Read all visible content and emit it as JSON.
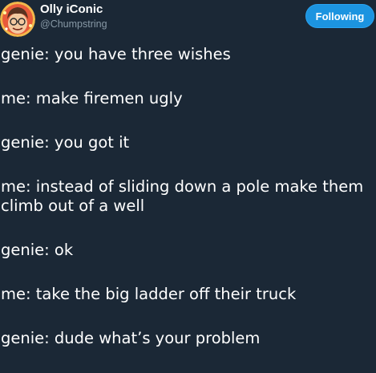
{
  "header": {
    "display_name": "Olly iConic",
    "handle": "@Chumpstring",
    "follow_button_label": "Following",
    "accent_color": "#1c94e0"
  },
  "tweet": {
    "lines": [
      "genie: you have three wishes",
      "me: make firemen ugly",
      "genie: you got it",
      "me: instead of sliding down a pole make them climb out of a well",
      "genie: ok",
      "me: take the big ladder off their truck",
      "genie: dude what’s your problem"
    ]
  }
}
